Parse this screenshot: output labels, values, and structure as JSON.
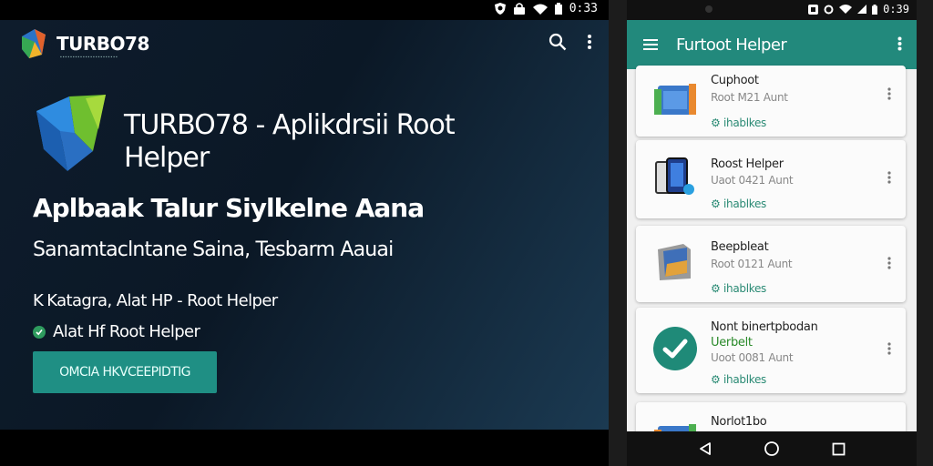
{
  "colors": {
    "accent_teal": "#22897c",
    "button_teal": "#1f8f84",
    "status_green": "#2e9b5e",
    "page_bg_dark": "#0e1c2c"
  },
  "left": {
    "status_bar": {
      "time": "0:33",
      "icons": [
        "shield-icon",
        "lock-icon",
        "wifi-icon",
        "battery-icon"
      ]
    },
    "brand": {
      "name": "TURBO78"
    },
    "top_actions": {
      "icons": [
        "search-icon",
        "more-vert-icon"
      ]
    },
    "hero": {
      "title": "TURBO78 - Aplikdrsii Root Helper",
      "subtitle": "Aplbaak Talur Siylkelne Aana",
      "description": "Sanamtaclntane Saina, Tesbarm Aauai"
    },
    "meta": {
      "category_prefix": "K",
      "category": "Katagra, Alat HP - Root Helper",
      "status": "Alat Hf Root Helper"
    },
    "cta_label": "OMCIA HKVCEEPIDTIG"
  },
  "phone": {
    "status_bar": {
      "time": "0:39",
      "icons": [
        "nfc-icon",
        "sync-icon",
        "wifi-icon",
        "signal-icon",
        "battery-icon"
      ]
    },
    "app_bar": {
      "title": "Furtoot Helper"
    },
    "cards": [
      {
        "icon": "folder-icon",
        "title": "Cuphoot",
        "subtitle": "Root M21 Aunt",
        "tag": "ihablkes"
      },
      {
        "icon": "phone-icon",
        "title": "Roost Helper",
        "subtitle": "Uaot 0421 Aunt",
        "tag": "ihablkes"
      },
      {
        "icon": "box-icon",
        "title": "Beepbleat",
        "subtitle": "Root 0121 Aunt",
        "tag": "ihablkes"
      },
      {
        "icon": "check-circle-icon",
        "title": "Nont binertpbodan",
        "status": "Uerbelt",
        "subtitle": "Uoot 0081 Aunt",
        "tag": "ihablkes"
      },
      {
        "icon": "folder-icon",
        "title": "Norlot1bo"
      }
    ],
    "nav": [
      "back-icon",
      "home-icon",
      "recents-icon"
    ]
  }
}
